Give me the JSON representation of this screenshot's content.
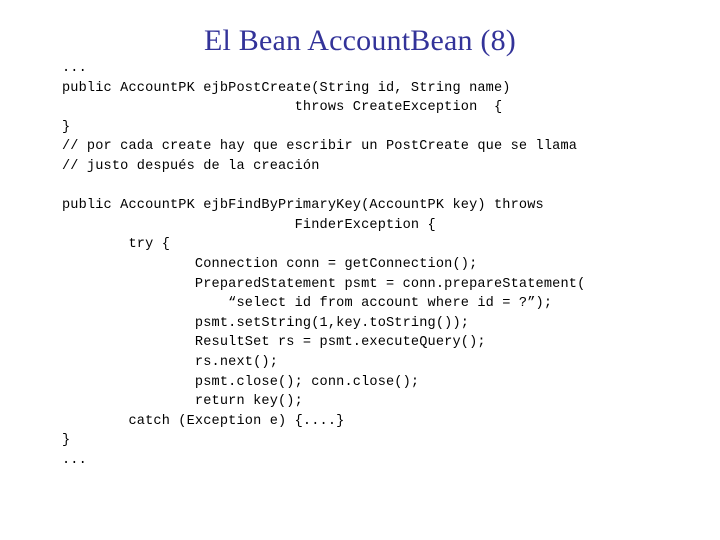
{
  "slide": {
    "title": "El Bean AccountBean (8)",
    "title_color": "#333399",
    "background_color": "#ffffff",
    "text_color": "#000000",
    "language": "java",
    "code_lines": [
      "...",
      "public AccountPK ejbPostCreate(String id, String name)",
      "                            throws CreateException  {",
      "}",
      "// por cada create hay que escribir un PostCreate que se llama",
      "// justo después de la creación",
      "",
      "public AccountPK ejbFindByPrimaryKey(AccountPK key) throws",
      "                            FinderException {",
      "        try {",
      "                Connection conn = getConnection();",
      "                PreparedStatement psmt = conn.prepareStatement(",
      "                    “select id from account where id = ?”);",
      "                psmt.setString(1,key.toString());",
      "                ResultSet rs = psmt.executeQuery();",
      "                rs.next();",
      "                psmt.close(); conn.close();",
      "                return key();",
      "        catch (Exception e) {....}",
      "}",
      "..."
    ]
  }
}
